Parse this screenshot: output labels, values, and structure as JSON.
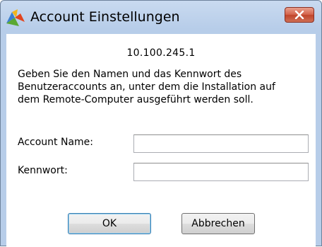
{
  "window": {
    "title": "Account Einstellungen",
    "icons": {
      "app": "avg-logo-icon",
      "close": "close-icon"
    }
  },
  "dialog": {
    "ip_address": "10.100.245.1",
    "description_lines": [
      "Geben Sie den Namen und das Kennwort des",
      "Benutzeraccounts an, unter dem die Installation auf",
      "dem Remote-Computer ausgeführt werden soll."
    ],
    "account_name_label": "Account Name:",
    "account_name_value": "",
    "password_label": "Kennwort:",
    "password_value": ""
  },
  "buttons": {
    "ok_label": "OK",
    "cancel_label": "Abbrechen"
  },
  "colors": {
    "frame": "#b7cde9",
    "close_button": "#c0442a",
    "logo": [
      "#3a7fd0",
      "#f2b51c",
      "#e2451f",
      "#5aa832"
    ]
  }
}
